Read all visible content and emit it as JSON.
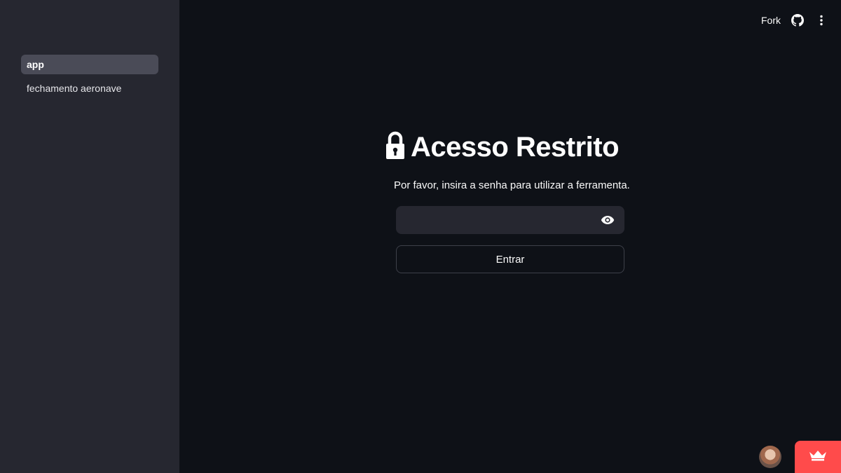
{
  "sidebar": {
    "items": [
      {
        "label": "app",
        "active": true
      },
      {
        "label": "fechamento aeronave",
        "active": false
      }
    ]
  },
  "header": {
    "fork_label": "Fork",
    "github_icon": "github-icon",
    "menu_icon": "vertical-ellipsis-icon"
  },
  "main": {
    "title_icon": "lock-icon",
    "title": "Acesso Restrito",
    "subtitle": "Por favor, insira a senha para utilizar a ferramenta.",
    "password": {
      "value": "",
      "placeholder": "",
      "toggle_icon": "eye-icon"
    },
    "submit_label": "Entrar"
  },
  "footer": {
    "avatar_icon": "user-avatar",
    "badge_icon": "crown-icon"
  },
  "colors": {
    "background": "#0e1117",
    "sidebar": "#262730",
    "active_item": "#4a4b57",
    "accent": "#ff4b4b"
  }
}
